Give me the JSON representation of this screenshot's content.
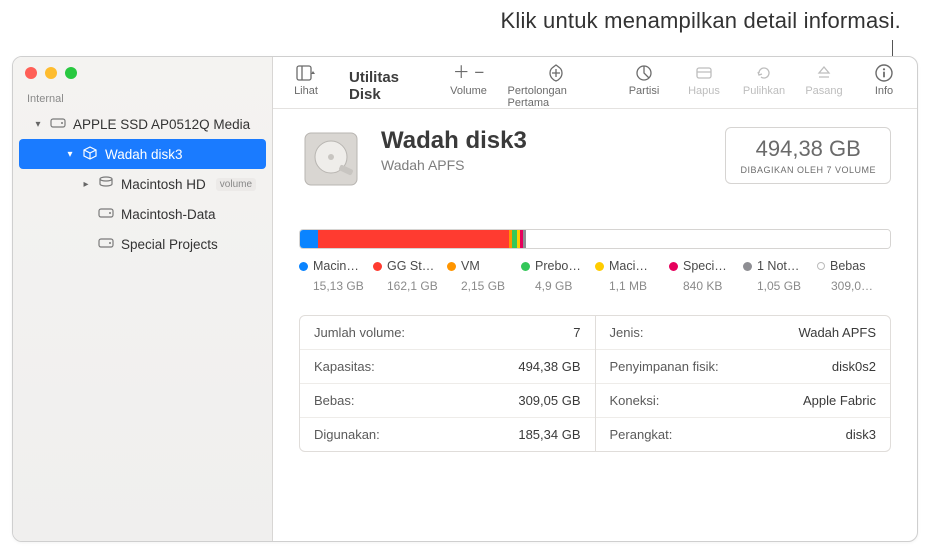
{
  "callout": "Klik untuk menampilkan detail informasi.",
  "app_title": "Utilitas Disk",
  "toolbar": {
    "view": "Lihat",
    "volume": "Volume",
    "firstaid": "Pertolongan Pertama",
    "partition": "Partisi",
    "erase": "Hapus",
    "restore": "Pulihkan",
    "mount": "Pasang",
    "info": "Info"
  },
  "sidebar": {
    "section": "Internal",
    "items": [
      {
        "label": "APPLE SSD AP0512Q Media"
      },
      {
        "label": "Wadah disk3"
      },
      {
        "label": "Macintosh HD",
        "badge": "volume"
      },
      {
        "label": "Macintosh-Data"
      },
      {
        "label": "Special Projects"
      }
    ]
  },
  "header": {
    "title": "Wadah disk3",
    "subtitle": "Wadah APFS",
    "capacity": "494,38 GB",
    "shared": "DIBAGIKAN OLEH 7 VOLUME"
  },
  "chart_data": {
    "type": "bar",
    "total_gb": 494.38,
    "series": [
      {
        "name": "Macin…",
        "value_label": "15,13 GB",
        "gb": 15.13,
        "color": "#0a84ff"
      },
      {
        "name": "GG St…",
        "value_label": "162,1 GB",
        "gb": 162.1,
        "color": "#ff3b30"
      },
      {
        "name": "VM",
        "value_label": "2,15 GB",
        "gb": 2.15,
        "color": "#ff9500"
      },
      {
        "name": "Prebo…",
        "value_label": "4,9 GB",
        "gb": 4.9,
        "color": "#34c759"
      },
      {
        "name": "Maci…",
        "value_label": "1,1 MB",
        "gb": 0.0011,
        "color": "#ffcc00"
      },
      {
        "name": "Speci…",
        "value_label": "840 KB",
        "gb": 0.00084,
        "color": "#e6005c"
      },
      {
        "name": "1 Not…",
        "value_label": "1,05 GB",
        "gb": 1.05,
        "color": "#8e8e93"
      },
      {
        "name": "Bebas",
        "value_label": "309,0…",
        "gb": 309.05,
        "color": "#ffffff",
        "hollow": true
      }
    ]
  },
  "details": {
    "left": [
      {
        "k": "Jumlah volume:",
        "v": "7"
      },
      {
        "k": "Kapasitas:",
        "v": "494,38 GB"
      },
      {
        "k": "Bebas:",
        "v": "309,05 GB"
      },
      {
        "k": "Digunakan:",
        "v": "185,34 GB"
      }
    ],
    "right": [
      {
        "k": "Jenis:",
        "v": "Wadah APFS"
      },
      {
        "k": "Penyimpanan fisik:",
        "v": "disk0s2"
      },
      {
        "k": "Koneksi:",
        "v": "Apple Fabric"
      },
      {
        "k": "Perangkat:",
        "v": "disk3"
      }
    ]
  }
}
